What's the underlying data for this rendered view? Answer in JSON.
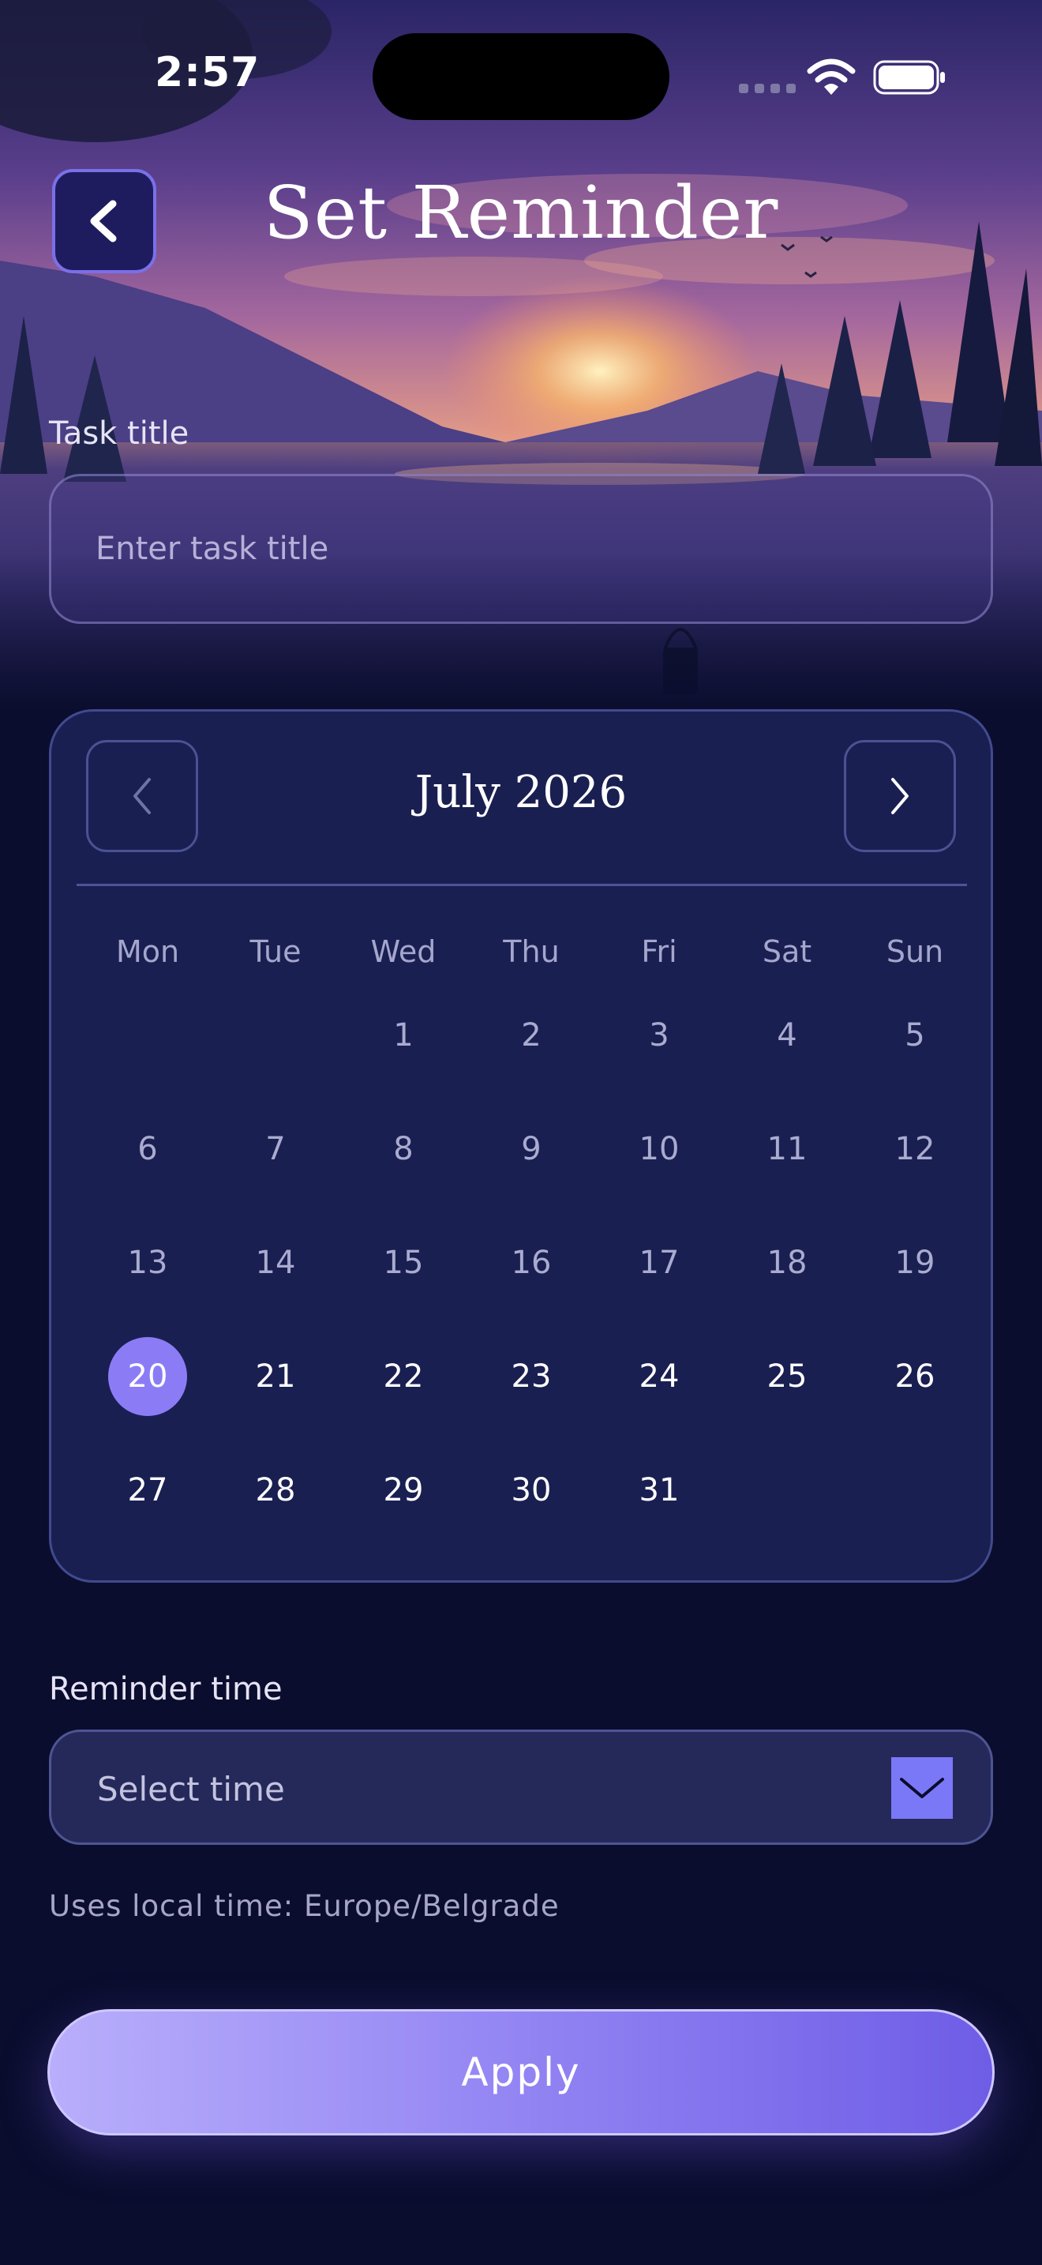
{
  "status_bar": {
    "time": "2:57"
  },
  "header": {
    "title": "Set Reminder"
  },
  "task": {
    "label": "Task title",
    "placeholder": "Enter task title"
  },
  "calendar": {
    "month": "July 2026",
    "weekdays": [
      "Mon",
      "Tue",
      "Wed",
      "Thu",
      "Fri",
      "Sat",
      "Sun"
    ],
    "days": [
      "1",
      "2",
      "3",
      "4",
      "5",
      "6",
      "7",
      "8",
      "9",
      "10",
      "11",
      "12",
      "13",
      "14",
      "15",
      "16",
      "17",
      "18",
      "19",
      "20",
      "21",
      "22",
      "23",
      "24",
      "25",
      "26",
      "27",
      "28",
      "29",
      "30",
      "31"
    ],
    "selected_day": "20"
  },
  "reminder": {
    "label": "Reminder time",
    "select_placeholder": "Select time",
    "timezone_note": "Uses local time: Europe/Belgrade"
  },
  "apply": {
    "label": "Apply"
  },
  "icons": {
    "back": "chevron-left-icon",
    "prev_month": "chevron-left-icon",
    "next_month": "chevron-right-icon",
    "dropdown": "chevron-down-icon",
    "wifi": "wifi-icon",
    "battery": "battery-icon",
    "signal": "signal-icon"
  },
  "colors": {
    "background": "#0b0d2e",
    "calendar_card": "#1a1f52",
    "accent": "#8b7cf6",
    "apply_gradient_start": "#b8aefb",
    "apply_gradient_end": "#6e5de6"
  }
}
